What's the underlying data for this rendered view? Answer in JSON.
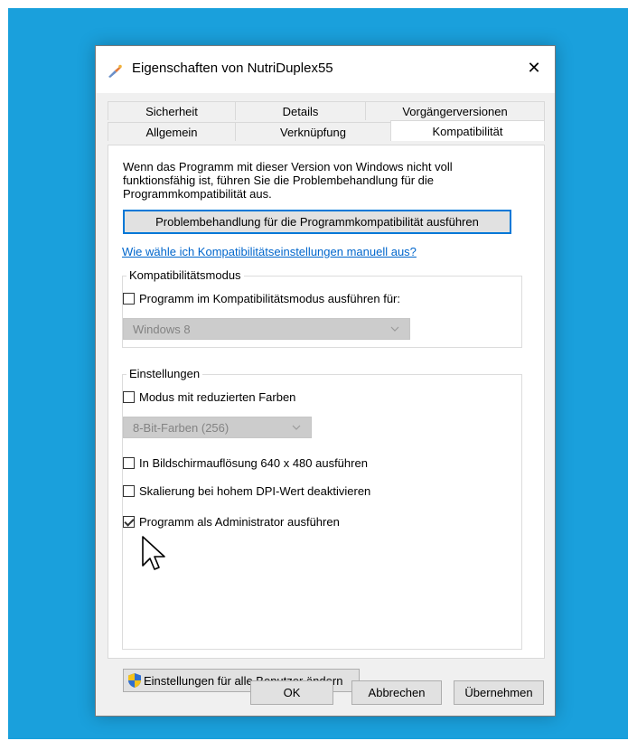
{
  "window": {
    "title": "Eigenschaften von NutriDuplex55",
    "close_glyph": "✕"
  },
  "tabs_row1": [
    "Sicherheit",
    "Details",
    "Vorgängerversionen"
  ],
  "tabs_row2": [
    "Allgemein",
    "Verknüpfung",
    "Kompatibilität"
  ],
  "active_tab": "Kompatibilität",
  "intro_lines": [
    "Wenn das Programm mit dieser Version von Windows nicht voll",
    "funktionsfähig ist, führen Sie die Problembehandlung für die",
    "Programmkompatibilität aus."
  ],
  "troubleshoot_button": "Problembehandlung für die Programmkompatibilität ausführen",
  "manual_link": "Wie wähle ich Kompatibilitätseinstellungen manuell aus?",
  "compat_mode": {
    "group_label": "Kompatibilitätsmodus",
    "checkbox_label": "Programm im Kompatibilitätsmodus ausführen für:",
    "checked": false,
    "select_value": "Windows 8"
  },
  "settings": {
    "group_label": "Einstellungen",
    "reduced_colors_label": "Modus mit reduzierten Farben",
    "color_select_value": "8-Bit-Farben (256)",
    "resolution_label": "In Bildschirmauflösung 640 x 480 ausführen",
    "dpi_label": "Skalierung bei hohem DPI-Wert deaktivieren",
    "admin_label": "Programm als Administrator ausführen",
    "admin_checked": true
  },
  "all_users_button": "Einstellungen für alle Benutzer ändern",
  "footer": {
    "ok": "OK",
    "cancel": "Abbrechen",
    "apply": "Übernehmen"
  },
  "icons": {
    "app": "app-icon",
    "shield": "uac-shield-icon",
    "cursor": "mouse-cursor-icon"
  },
  "colors": {
    "desktop": "#1aa0dc",
    "link": "#0066cc",
    "focus": "#0078d7"
  }
}
